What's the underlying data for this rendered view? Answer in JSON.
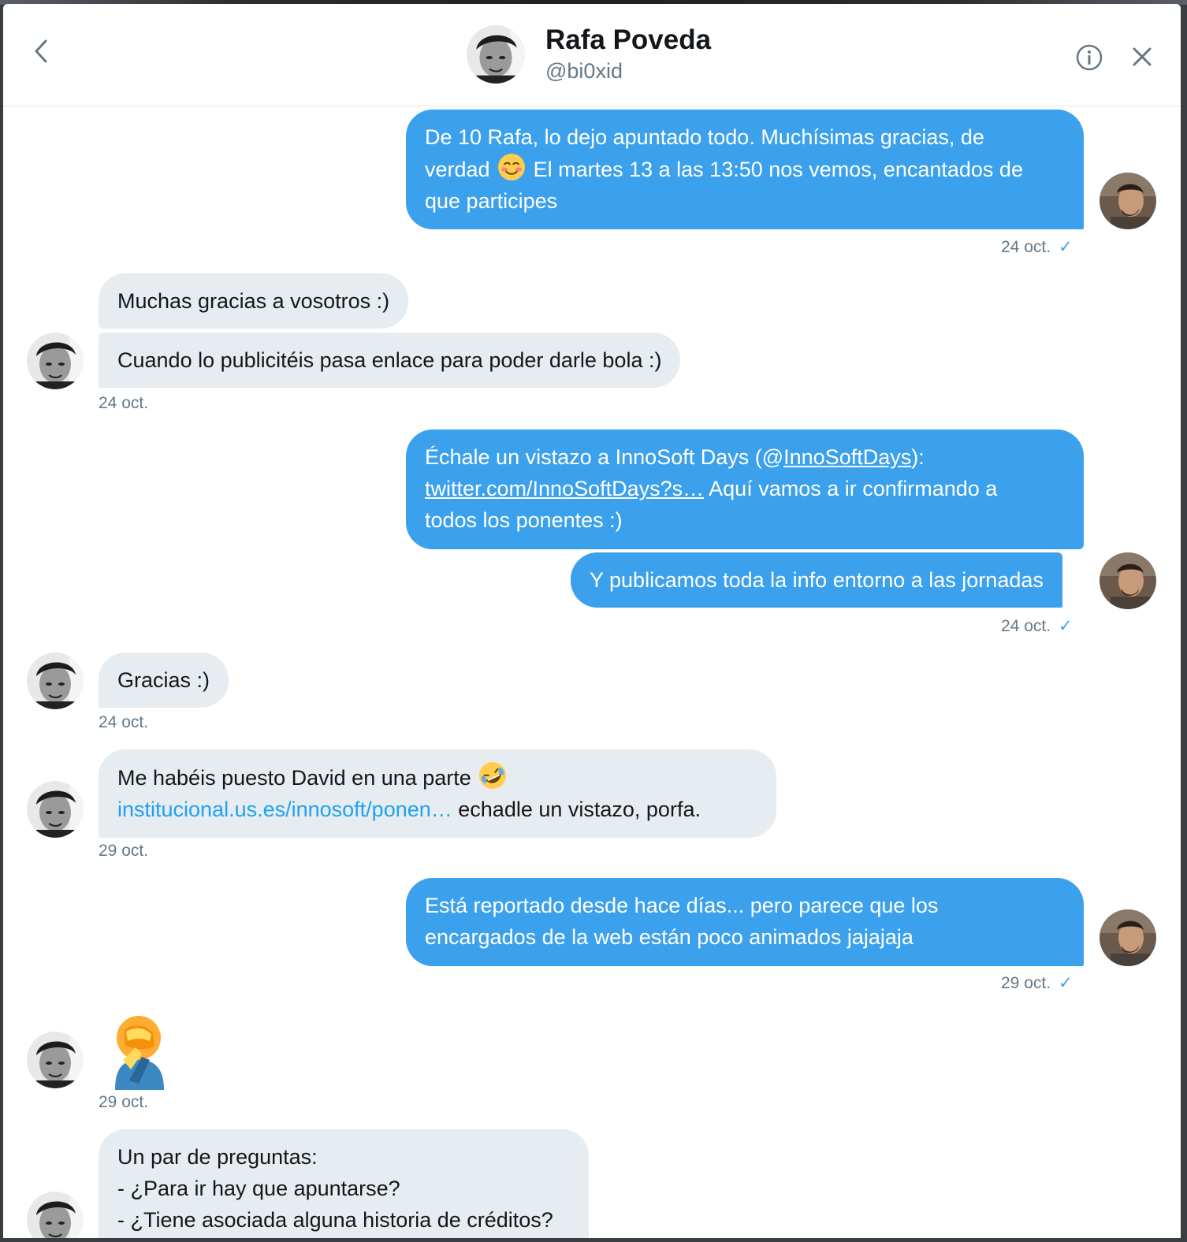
{
  "header": {
    "name": "Rafa Poveda",
    "handle": "@bi0xid"
  },
  "messages": {
    "m1": {
      "line1": "De 10 Rafa, lo dejo apuntado todo. Muchísimas gracias, de",
      "line2a": "verdad",
      "line2b": "El martes 13 a las 13:50 nos vemos, encantados de",
      "line3": "que participes",
      "time": "24 oct."
    },
    "m2": {
      "text": "Muchas gracias a vosotros :)"
    },
    "m3": {
      "text": "Cuando lo publicitéis pasa enlace para poder darle bola :)",
      "time": "24 oct."
    },
    "m4": {
      "line1a": "Échale un vistazo a InnoSoft Days (@",
      "line1link": "InnoSoftDays",
      "line1b": "):",
      "line2link": "twitter.com/InnoSoftDays?s…",
      "line2b": " Aquí vamos a ir confirmando a",
      "line3": "todos los ponentes :)"
    },
    "m5": {
      "text": "Y publicamos toda la info entorno a las jornadas",
      "time": "24 oct."
    },
    "m6": {
      "text": "Gracias :)",
      "time": "24 oct."
    },
    "m7": {
      "line1": "Me habéis puesto David en una parte",
      "line2link": "institucional.us.es/innosoft/ponen…",
      "line2b": " echadle un vistazo, porfa.",
      "time": "29 oct."
    },
    "m8": {
      "line1": "Está reportado desde hace días... pero parece que los",
      "line2": "encargados de la web están poco animados jajajaja",
      "time": "29 oct."
    },
    "m9": {
      "emoji": "face-palm-emoji",
      "time": "29 oct."
    },
    "m10": {
      "line1": "Un par de preguntas:",
      "line2": "- ¿Para ir hay que apuntarse?",
      "line3": "- ¿Tiene asociada alguna historia de créditos?"
    }
  },
  "colors": {
    "outgoing_bubble": "#3ca1ec",
    "incoming_bubble": "#e6ecf0",
    "link": "#1da1f2",
    "timestamp": "#657786"
  },
  "icons": {
    "back": "chevron-left-icon",
    "info": "info-icon",
    "close": "close-icon",
    "read": "check-icon"
  }
}
